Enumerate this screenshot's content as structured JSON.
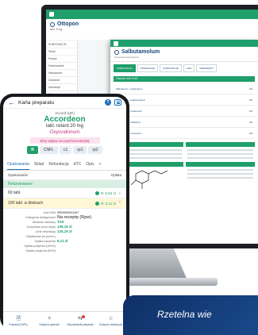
{
  "desktop": {
    "main_title": "Ottopon",
    "main_sub": "tabl. 8 mg",
    "left_rows": [
      "SUBSTANCJE",
      "Skład",
      "Postać",
      "Dawkowanie",
      "Wskazania",
      "Działanie",
      "Interakcje",
      "Ciąża",
      "Przedawkow."
    ],
    "popup_title": "Salbutamolum",
    "popup_sub": "Grupa farmakologiczna",
    "popup_tabs": [
      "SUBSTANCJA",
      "INTERAKCJE",
      "SUBSTANCJE",
      "LEKI",
      "PREPARATY"
    ],
    "popup_band": "Obecne leki: 4/10",
    "popup_rows": [
      {
        "label": "Salbutamol + ipratropium",
        "badge": "2/4"
      },
      {
        "label": "Salbutamol + beklometazon",
        "badge": "2/4"
      },
      {
        "label": "Salbutamol + budezonid",
        "badge": "2/4"
      },
      {
        "label": "Salbutamol + flutikazon",
        "badge": "2/4"
      },
      {
        "label": "Salbutamol + formoterol",
        "badge": "2/4"
      }
    ]
  },
  "phone": {
    "header_title": "Karta preparatu",
    "company": "Accord (UK)",
    "drug_name": "Accordeon",
    "drug_form": "tabl. retard 20 mg",
    "drug_sub": "Oxycodonum",
    "warning": "silny wpływ na psychomotorykę",
    "tags": [
      "R",
      "CNFL",
      "c1",
      "rp1",
      "rp2"
    ],
    "tabs": [
      "Opakowania",
      "Skład",
      "Refundacja",
      "ATC",
      "Opis",
      "+"
    ],
    "pack_head_left": "Opakowanie",
    "pack_head_right": "Opłata",
    "refund_band": "Refundowane",
    "packs": [
      {
        "name": "60 tabl.",
        "price": "R: 5,94 zł"
      },
      {
        "name": "100 tabl. w blistrach",
        "price": "R: 6,11 zł"
      }
    ],
    "details": [
      {
        "k": "kod EAN",
        "v": "5909990941287"
      },
      {
        "k": "Kategoria dostępności",
        "v": "Na receptę (Rpw)"
      },
      {
        "k": "Możliwe zamiany",
        "v": "TAK"
      },
      {
        "k": "Urzędowa cena zbytu",
        "v": "135,19 zł"
      },
      {
        "k": "Limit refundacji",
        "v": "135,19 zł"
      },
      {
        "k": "Odpłatność (w przew.)",
        "v": ""
      },
      {
        "k": "Opłata pacjenta",
        "v": "6,11 zł"
      },
      {
        "k": "Opłata pacjenta (100%)",
        "v": ""
      },
      {
        "k": "Opłata pacjenta (50%)",
        "v": ""
      }
    ],
    "nav": [
      {
        "label": "Preparat (CHPL)",
        "icon": "document-icon"
      },
      {
        "label": "Dodaj do apteczki",
        "icon": "pills-icon"
      },
      {
        "label": "Odpowiedniki preparatu",
        "icon": "swap-icon"
      },
      {
        "label": "Dodaj do ulubionych",
        "icon": "star-icon"
      }
    ]
  },
  "banner": {
    "text": "Rzetelna wie"
  },
  "colors": {
    "brand_green": "#1f9f6b",
    "brand_blue": "#1a4a7a",
    "accent_pink": "#c7297f"
  }
}
